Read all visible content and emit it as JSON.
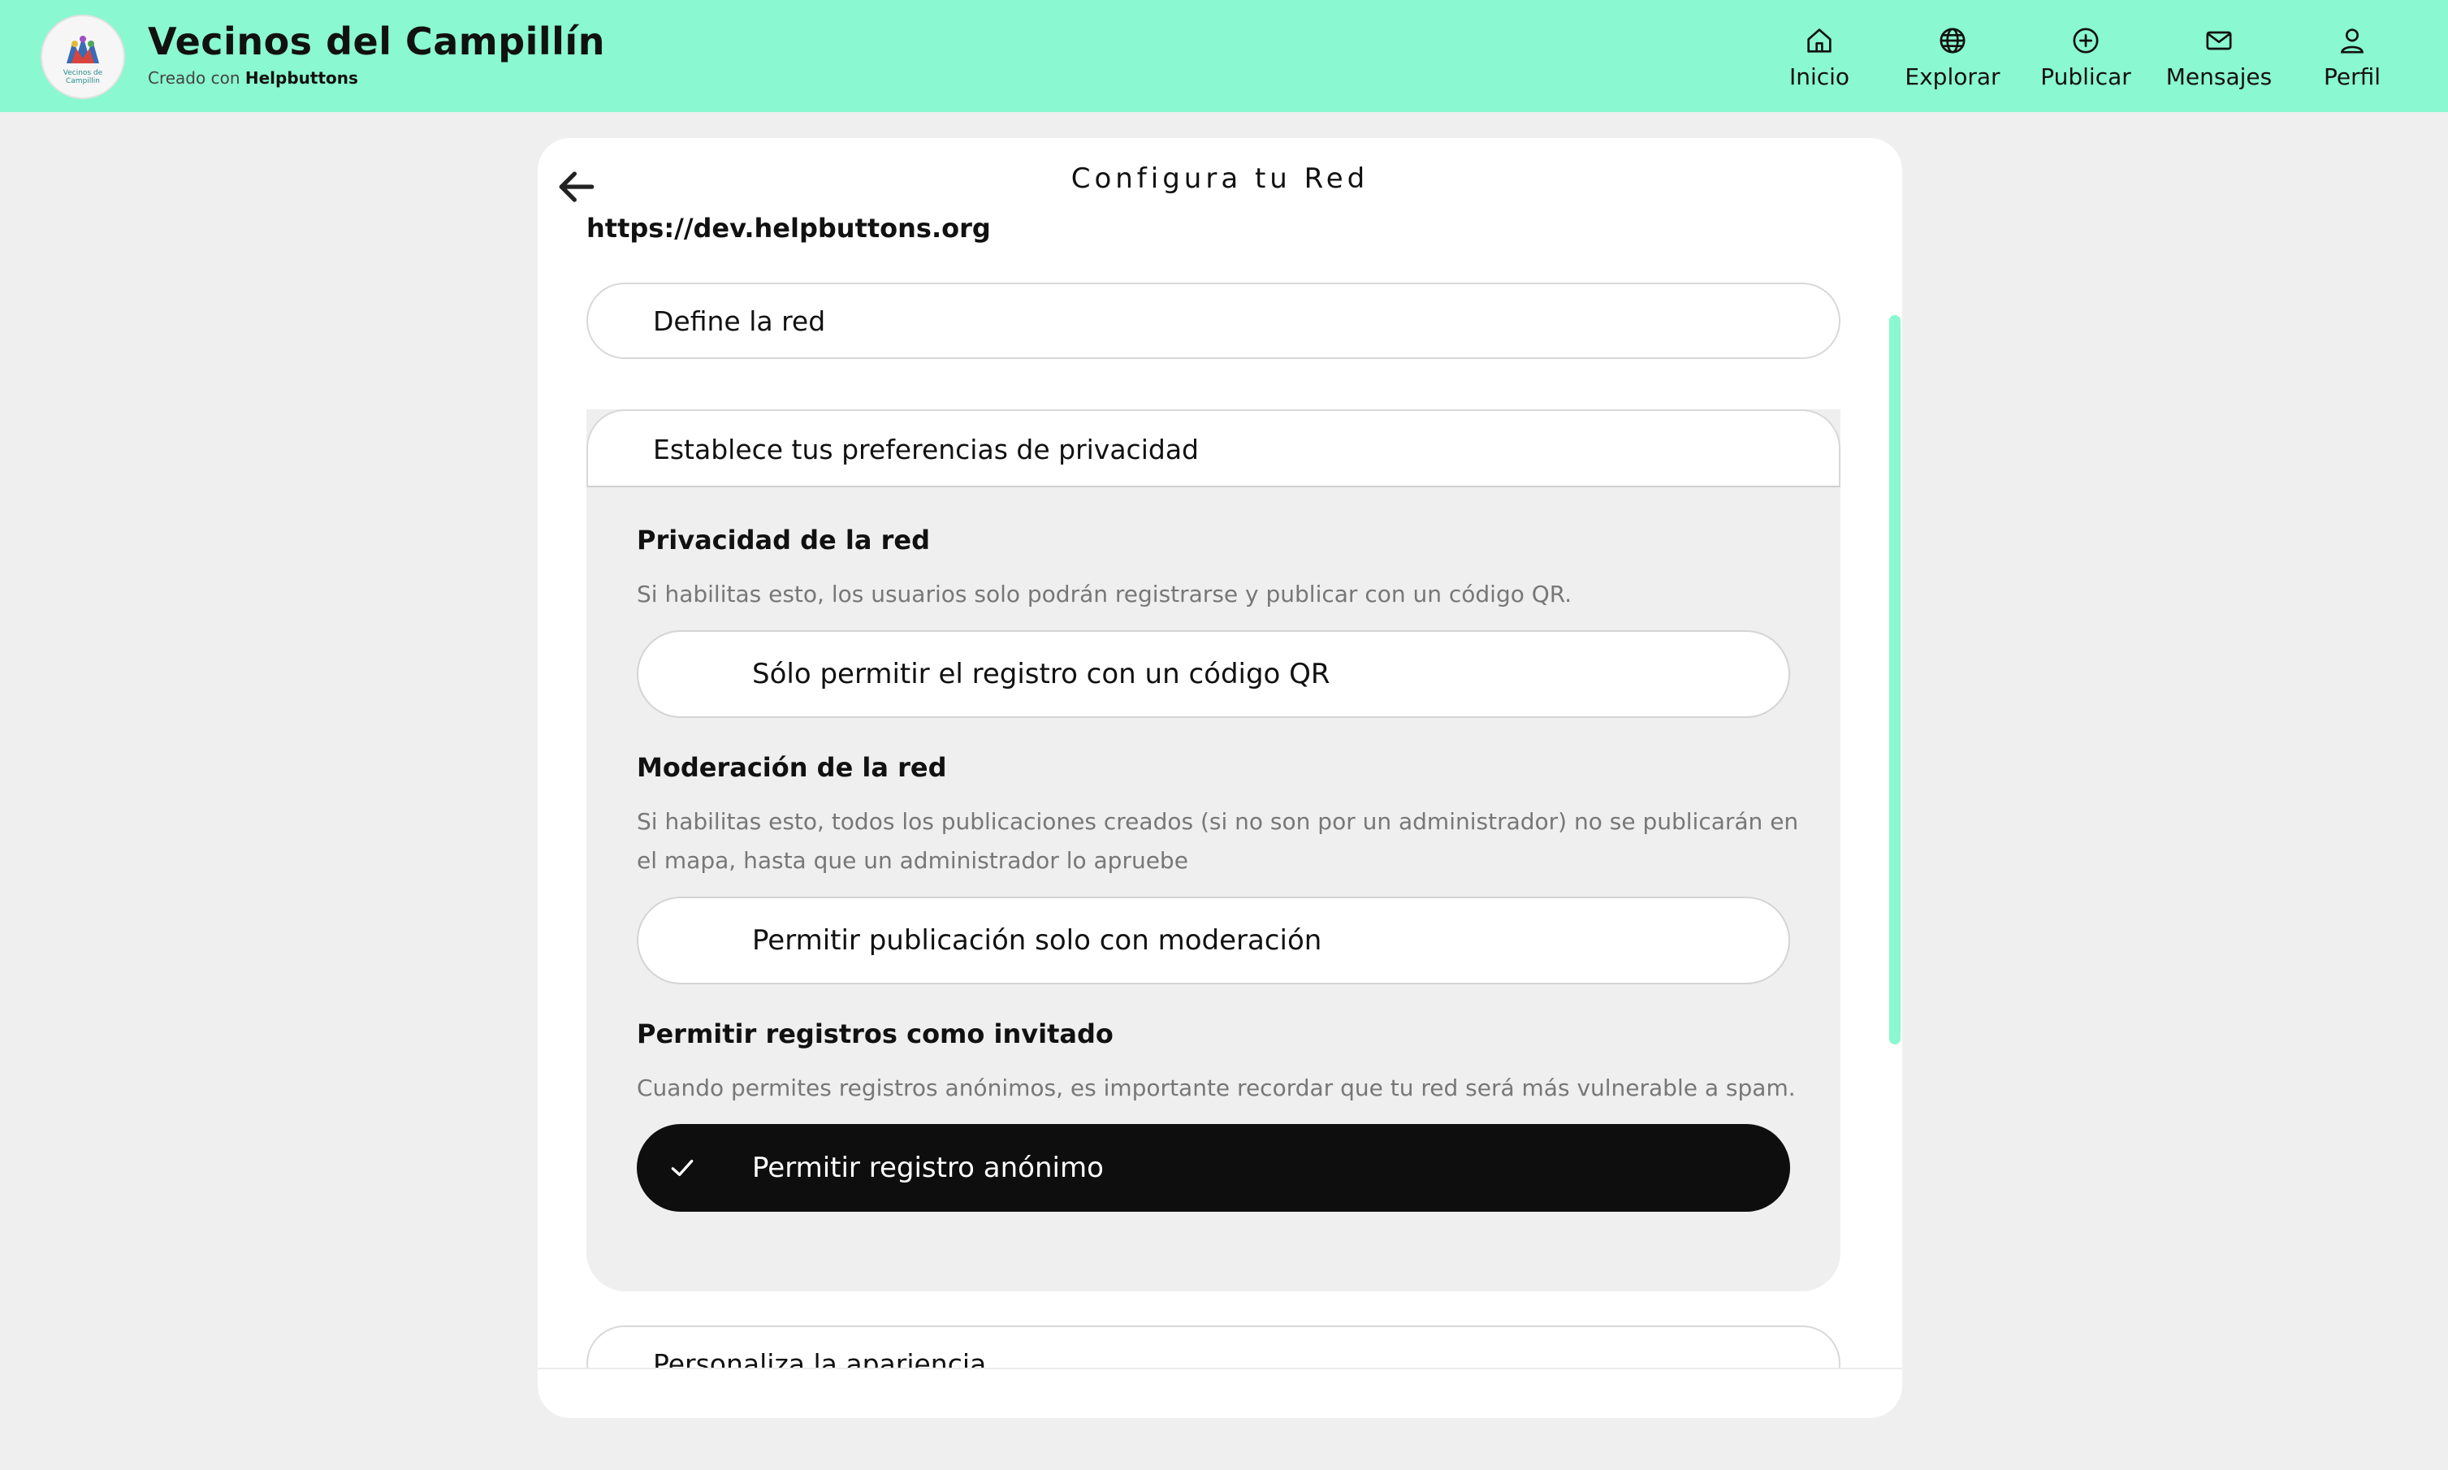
{
  "header": {
    "title": "Vecinos del Campillín",
    "subtitle_prefix": "Creado con",
    "subtitle_brand": "Helpbuttons",
    "background_color": "#8af8d0",
    "logo_text_line1": "Vecinos de",
    "logo_text_line2": "Campillin",
    "nav": [
      {
        "label": "Inicio",
        "icon": "home-icon"
      },
      {
        "label": "Explorar",
        "icon": "globe-icon"
      },
      {
        "label": "Publicar",
        "icon": "plus-circle-icon"
      },
      {
        "label": "Mensajes",
        "icon": "mail-icon"
      },
      {
        "label": "Perfil",
        "icon": "user-icon"
      }
    ]
  },
  "card": {
    "title": "Configura tu Red",
    "url": "https://dev.helpbuttons.org",
    "sections": {
      "define": "Define la red",
      "privacy": "Establece tus preferencias de privacidad",
      "appearance": "Personaliza la apariencia"
    },
    "privacy_panel": {
      "network_privacy": {
        "title": "Privacidad de la red",
        "description": "Si habilitas esto, los usuarios solo podrán registrarse y publicar con un código QR.",
        "toggle_label": "Sólo permitir el registro con un código QR",
        "enabled": false
      },
      "moderation": {
        "title": "Moderación de la red",
        "description": "Si habilitas esto, todos los publicaciones creados (si no son por un administrador) no se publicarán en el mapa, hasta que un administrador lo apruebe",
        "toggle_label": "Permitir publicación solo con moderación",
        "enabled": false
      },
      "guest": {
        "title": "Permitir registros como invitado",
        "description": "Cuando permites registros anónimos, es importante recordar que tu red será más vulnerable a spam.",
        "toggle_label": "Permitir registro anónimo",
        "enabled": true
      }
    }
  },
  "colors": {
    "accent": "#8af8d0",
    "toggle_on": "#0e0e0e",
    "page_background": "#efefef"
  }
}
